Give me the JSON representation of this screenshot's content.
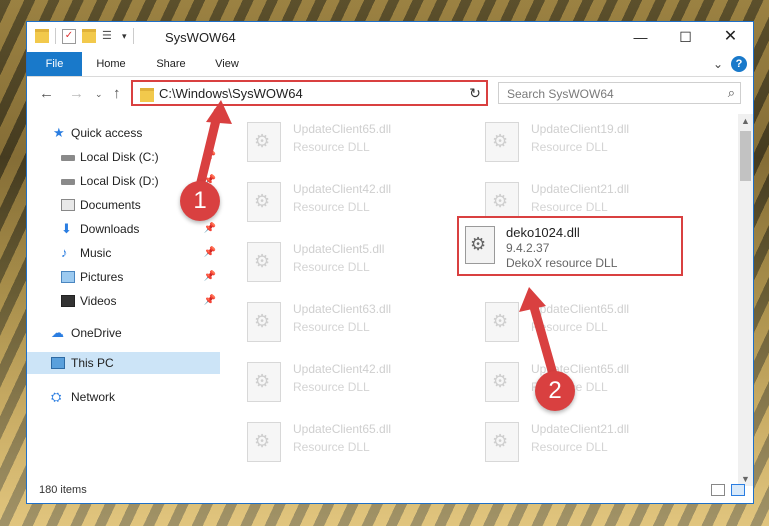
{
  "window": {
    "title": "SysWOW64"
  },
  "controls": {
    "minimize": "—",
    "maximize": "☐",
    "close": "✕"
  },
  "ribbon": {
    "tabs": [
      "File",
      "Home",
      "Share",
      "View"
    ],
    "help": "?"
  },
  "nav": {
    "back": "←",
    "forward": "→",
    "recent": "⌄",
    "up": "↑"
  },
  "address": {
    "path": "C:\\Windows\\SysWOW64",
    "refresh": "↻",
    "chevron": "⌄"
  },
  "search": {
    "placeholder": "Search SysWOW64",
    "icon": "search-icon"
  },
  "sidebar": {
    "items": [
      {
        "label": "Quick access",
        "icon": "star-icon"
      },
      {
        "label": "Local Disk (C:)",
        "icon": "disk-icon",
        "pinned": true
      },
      {
        "label": "Local Disk (D:)",
        "icon": "disk-icon",
        "pinned": true
      },
      {
        "label": "Documents",
        "icon": "documents-icon",
        "pinned": true
      },
      {
        "label": "Downloads",
        "icon": "download-icon",
        "pinned": true
      },
      {
        "label": "Music",
        "icon": "music-icon",
        "pinned": true
      },
      {
        "label": "Pictures",
        "icon": "pictures-icon",
        "pinned": true
      },
      {
        "label": "Videos",
        "icon": "videos-icon",
        "pinned": true
      },
      {
        "label": "OneDrive",
        "icon": "cloud-icon"
      },
      {
        "label": "This PC",
        "icon": "pc-icon",
        "selected": true
      },
      {
        "label": "Network",
        "icon": "network-icon"
      }
    ]
  },
  "files": {
    "left": [
      {
        "name": "UpdateClient65.dll",
        "desc": "Resource DLL"
      },
      {
        "name": "UpdateClient42.dll",
        "desc": "Resource DLL"
      },
      {
        "name": "UpdateClient5.dll",
        "desc": "Resource DLL"
      },
      {
        "name": "UpdateClient63.dll",
        "desc": "Resource DLL"
      },
      {
        "name": "UpdateClient42.dll",
        "desc": "Resource DLL"
      },
      {
        "name": "UpdateClient65.dll",
        "desc": "Resource DLL"
      }
    ],
    "right": [
      {
        "name": "UpdateClient19.dll",
        "desc": "Resource DLL"
      },
      {
        "name": "UpdateClient21.dll",
        "desc": "Resource DLL"
      },
      {
        "name": "UpdateClient65.dll",
        "desc": "Resource DLL"
      },
      {
        "name": "UpdateClient65.dll",
        "desc": "Resource DLL"
      },
      {
        "name": "UpdateClient21.dll",
        "desc": "Resource DLL"
      }
    ],
    "highlighted": {
      "name": "deko1024.dll",
      "version": "9.4.2.37",
      "desc": "DekoX resource DLL"
    }
  },
  "status": {
    "items": "180 items"
  },
  "callouts": {
    "one": "1",
    "two": "2"
  },
  "colors": {
    "accent": "#1979ca",
    "highlight": "#d94040",
    "selected": "#cce4f7"
  }
}
